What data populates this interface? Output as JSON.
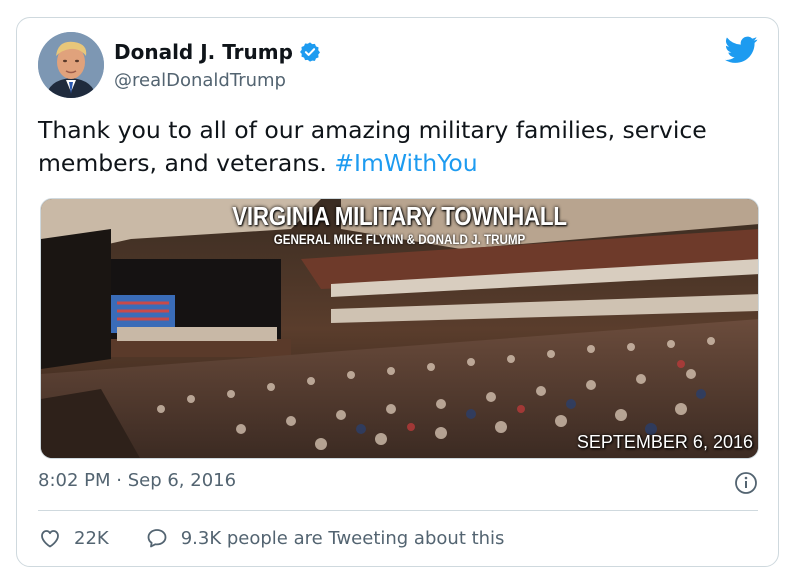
{
  "author": {
    "display_name": "Donald J. Trump",
    "handle": "@realDonaldTrump",
    "verified_icon": "verified-badge-icon"
  },
  "tweet": {
    "text": "Thank you to all of our amazing military families, service members, and veterans. ",
    "hashtag": "#ImWithYou"
  },
  "media": {
    "title": "VIRGINIA MILITARY TOWNHALL",
    "subtitle": "GENERAL MIKE FLYNN & DONALD J. TRUMP",
    "date": "SEPTEMBER 6, 2016"
  },
  "meta": {
    "timestamp": "8:02 PM · Sep 6, 2016"
  },
  "engagement": {
    "likes": "22K",
    "conversation": "9.3K people are Tweeting about this"
  },
  "colors": {
    "accent": "#1d9bf0",
    "secondary_text": "#536471",
    "border": "#cfd9de"
  }
}
